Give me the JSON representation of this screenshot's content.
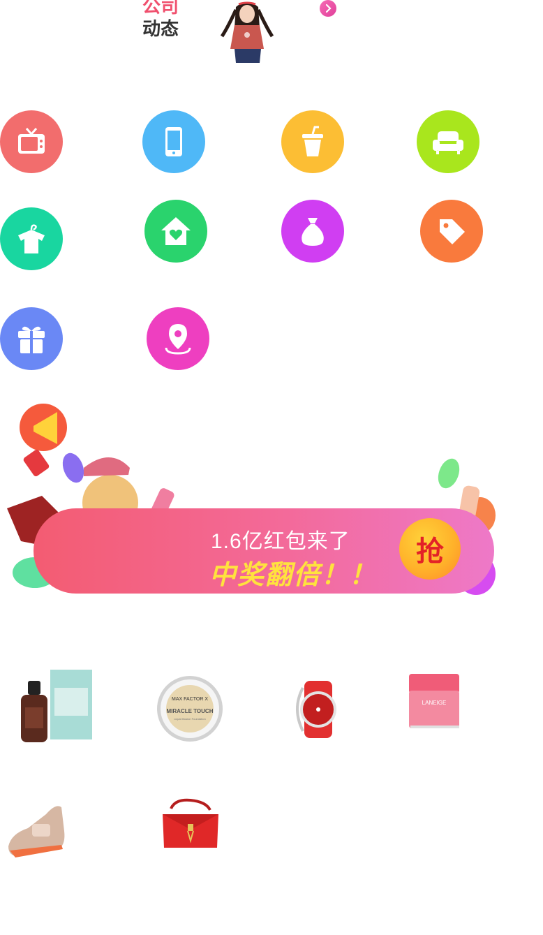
{
  "news": {
    "title_line1": "公司",
    "title_line2": "动态",
    "avatar_icon": "model-photo",
    "more_icon": "chevron-right-icon"
  },
  "categories": [
    {
      "icon": "tv-icon",
      "color": "#f26d6d"
    },
    {
      "icon": "phone-icon",
      "color": "#4fb8f7"
    },
    {
      "icon": "drink-cup-icon",
      "color": "#fcbe34"
    },
    {
      "icon": "sofa-icon",
      "color": "#a9e61d"
    },
    {
      "icon": "clothes-hanger-icon",
      "color": "#19d6a0"
    },
    {
      "icon": "home-heart-icon",
      "color": "#2ad36d"
    },
    {
      "icon": "money-bag-icon",
      "color": "#d03ef2"
    },
    {
      "icon": "tag-icon",
      "color": "#f97a3d"
    },
    {
      "icon": "gift-icon",
      "color": "#6a88f5"
    },
    {
      "icon": "location-pin-icon",
      "color": "#ee3fc0"
    }
  ],
  "banner": {
    "line1": "1.6亿红包来了",
    "line2": "中奖翻倍！！",
    "grab_label": "抢"
  },
  "products": [
    {
      "icon": "serum-bottle-product"
    },
    {
      "icon": "foundation-compact-product",
      "brand": "MAX FACTOR X",
      "name": "MIRACLE TOUCH",
      "sub": "Liquid Illusion Foundation"
    },
    {
      "icon": "red-watch-product"
    },
    {
      "icon": "lip-mask-jar-product",
      "brand": "LANEIGE"
    },
    {
      "icon": "sneaker-product"
    },
    {
      "icon": "red-handbag-product"
    }
  ]
}
